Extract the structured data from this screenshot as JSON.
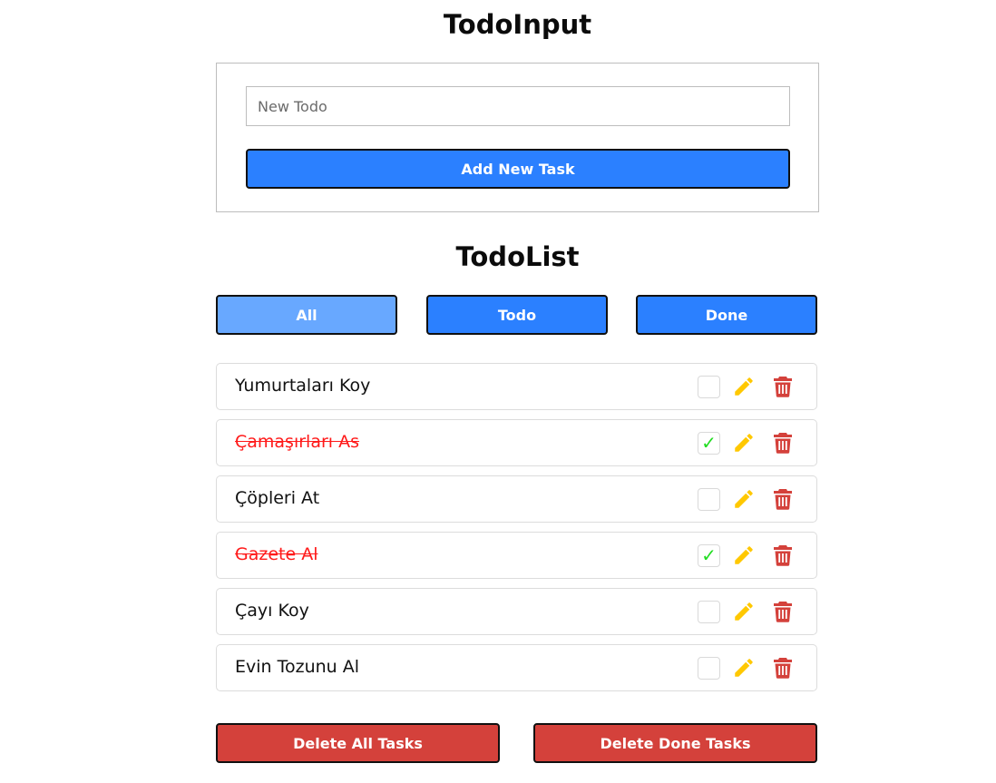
{
  "input_section": {
    "title": "TodoInput",
    "placeholder": "New Todo",
    "add_button": "Add New Task"
  },
  "list_section": {
    "title": "TodoList",
    "filters": [
      {
        "label": "All",
        "active": true
      },
      {
        "label": "Todo",
        "active": false
      },
      {
        "label": "Done",
        "active": false
      }
    ],
    "items": [
      {
        "text": "Yumurtaları Koy",
        "done": false
      },
      {
        "text": "Çamaşırları As",
        "done": true
      },
      {
        "text": "Çöpleri At",
        "done": false
      },
      {
        "text": "Gazete Al",
        "done": true
      },
      {
        "text": "Çayı Koy",
        "done": false
      },
      {
        "text": "Evin Tozunu Al",
        "done": false
      }
    ],
    "delete_all": "Delete All Tasks",
    "delete_done": "Delete Done Tasks"
  },
  "icons": {
    "check": "check-icon",
    "edit": "pencil-icon",
    "delete": "trash-icon"
  },
  "colors": {
    "primary": "#2b80ff",
    "primary_active": "#68a8ff",
    "danger": "#d4413b",
    "edit": "#ffc800",
    "done_text": "#ff1a1a",
    "check": "#22dd22"
  }
}
